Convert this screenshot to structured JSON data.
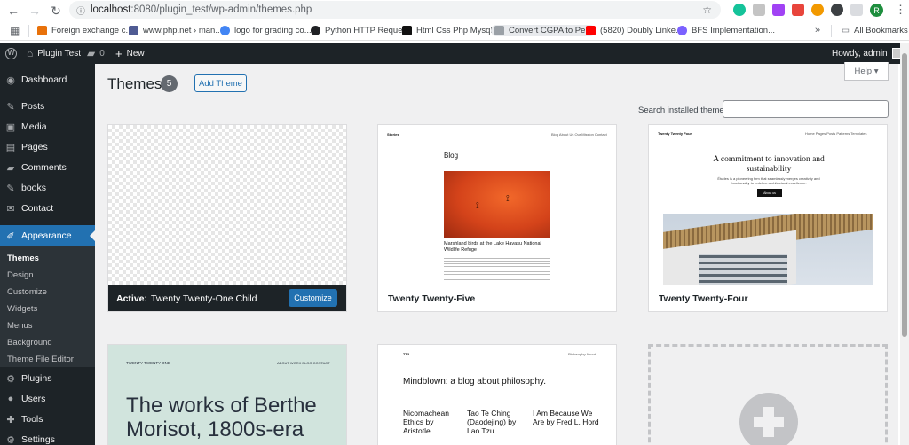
{
  "browser": {
    "url_host": "localhost",
    "url_path": ":8080/plugin_test/wp-admin/themes.php",
    "profile_initial": "R",
    "bookmarks": [
      {
        "label": "Foreign exchange c...",
        "color": "#e8710a"
      },
      {
        "label": "www.php.net › man...",
        "color": "#4f5b93"
      },
      {
        "label": "logo for grading co...",
        "color": "#4285f4"
      },
      {
        "label": "Python HTTP Reque...",
        "color": "#202124"
      },
      {
        "label": "Html Css Php Mysql...",
        "color": "#111111"
      },
      {
        "label": "Convert CGPA to Pe...",
        "color": "#9aa0a6"
      },
      {
        "label": "(5820) Doubly Linke...",
        "color": "#ff0000"
      },
      {
        "label": "BFS Implementation...",
        "color": "#7b61ff"
      }
    ],
    "all_bookmarks": "All Bookmarks",
    "more": "»"
  },
  "adminbar": {
    "site_name": "Plugin Test",
    "comments": "0",
    "new": "New",
    "howdy": "Howdy, admin"
  },
  "sidebar": {
    "items": [
      {
        "label": "Dashboard",
        "icon": "dashboard-icon",
        "glyph": "◉"
      },
      {
        "label": "Posts",
        "icon": "pin-icon",
        "glyph": "✎"
      },
      {
        "label": "Media",
        "icon": "media-icon",
        "glyph": "▣"
      },
      {
        "label": "Pages",
        "icon": "pages-icon",
        "glyph": "▤"
      },
      {
        "label": "Comments",
        "icon": "comment-icon",
        "glyph": "▰"
      },
      {
        "label": "books",
        "icon": "pin-icon",
        "glyph": "✎"
      },
      {
        "label": "Contact",
        "icon": "mail-icon",
        "glyph": "✉"
      },
      {
        "label": "Appearance",
        "icon": "brush-icon",
        "glyph": "✐"
      },
      {
        "label": "Plugins",
        "icon": "plugin-icon",
        "glyph": "⚙"
      },
      {
        "label": "Users",
        "icon": "users-icon",
        "glyph": "●"
      },
      {
        "label": "Tools",
        "icon": "tools-icon",
        "glyph": "✚"
      },
      {
        "label": "Settings",
        "icon": "settings-icon",
        "glyph": "⚙"
      }
    ],
    "submenu": [
      "Themes",
      "Design",
      "Customize",
      "Widgets",
      "Menus",
      "Background",
      "Theme File Editor"
    ]
  },
  "main": {
    "title": "Themes",
    "count": "5",
    "add_theme": "Add Theme",
    "help": "Help ▾",
    "search_label": "Search installed themes",
    "active_prefix": "Active:",
    "active_theme": "Twenty Twenty-One Child",
    "customize": "Customize",
    "themes": [
      {
        "name": "Twenty Twenty-Five"
      },
      {
        "name": "Twenty Twenty-Four"
      }
    ],
    "tt5_preview": {
      "site": "Stories",
      "nav": "Blog  About Us  Our Mission  Contact",
      "heading": "Blog",
      "caption": "Marshland birds at the Lake Havasu National Wildlife Refuge"
    },
    "tt4_preview": {
      "site": "Twenty Twenty Four",
      "nav": "Home  Pages  Posts  Patterns  Templates",
      "headline": "A commitment to innovation and sustainability",
      "sub": "Études is a pioneering firm that seamlessly merges creativity and functionality to redefine architectural excellence.",
      "button": "About us"
    },
    "tt1_preview": {
      "site": "TWENTY TWENTY-ONE",
      "nav": "ABOUT  WORK  BLOG  CONTACT",
      "headline": "The works of Berthe Morisot, 1800s-era"
    },
    "tt3_preview": {
      "site": "TT3",
      "nav": "Philosophy  About",
      "headline": "Mindblown: a blog about philosophy.",
      "posts": [
        "Nicomachean Ethics by Aristotle",
        "Tao Te Ching (Daodejing) by Lao Tzu",
        "I Am Because We Are by Fred L. Hord"
      ]
    }
  }
}
